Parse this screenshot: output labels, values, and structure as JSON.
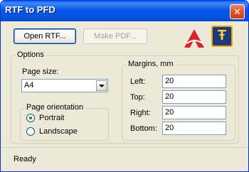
{
  "window": {
    "title": "RTF to PFD",
    "close_glyph": "✕"
  },
  "toolbar": {
    "open_rtf_label": "Open RTF...",
    "make_pdf_label": "Make PDF..."
  },
  "logos": {
    "pdf_logo_icon": "pdf-logo-icon",
    "t_logo_glyph": "Ŧ"
  },
  "options": {
    "label": "Options",
    "page_size_label": "Page size:",
    "page_size_value": "A4",
    "orientation": {
      "label": "Page orientation",
      "portrait_label": "Portrait",
      "landscape_label": "Landscape",
      "selected": "Portrait"
    },
    "margins": {
      "label": "Margins, mm",
      "left_label": "Left:",
      "top_label": "Top:",
      "right_label": "Right:",
      "bottom_label": "Bottom:",
      "left_value": "20",
      "top_value": "20",
      "right_value": "20",
      "bottom_value": "20"
    }
  },
  "status": {
    "text": "Ready"
  }
}
